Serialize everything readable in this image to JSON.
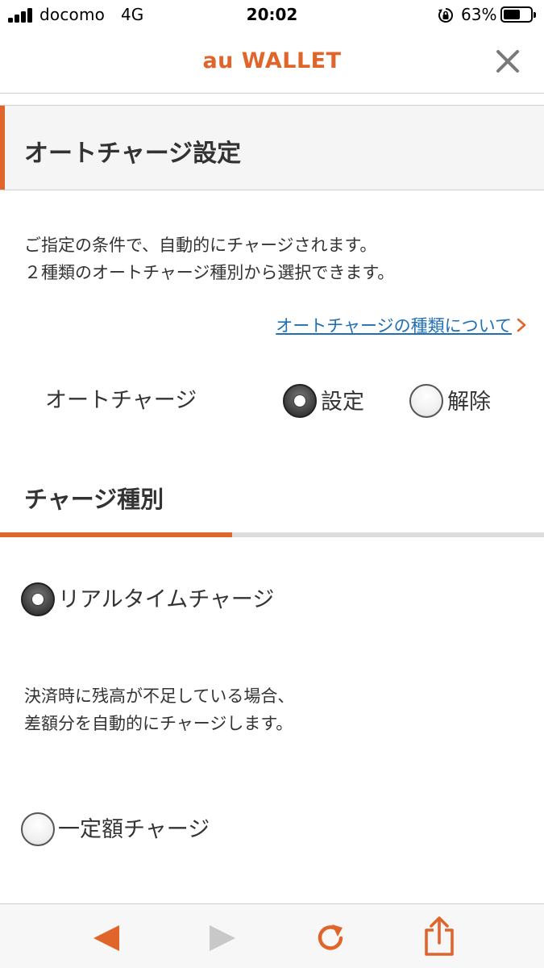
{
  "status_bar": {
    "carrier": "docomo",
    "network": "4G",
    "time": "20:02",
    "battery_percent": "63%",
    "battery_level": 0.63,
    "icons": [
      "signal-icon",
      "orientation-lock-icon",
      "battery-icon"
    ]
  },
  "header": {
    "title": "au WALLET",
    "close_icon": "close-icon"
  },
  "section": {
    "title": "オートチャージ設定"
  },
  "description": {
    "line1": "ご指定の条件で、自動的にチャージされます。",
    "line2": "２種類のオートチャージ種別から選択できます。"
  },
  "about_link": {
    "label": "オートチャージの種類について",
    "icon": "chevron-right-icon"
  },
  "autocharge": {
    "label": "オートチャージ",
    "options": [
      {
        "label": "設定",
        "selected": true
      },
      {
        "label": "解除",
        "selected": false
      }
    ]
  },
  "charge_type": {
    "heading": "チャージ種別",
    "options": [
      {
        "label": "リアルタイムチャージ",
        "selected": true,
        "description_line1": "決済時に残高が不足している場合、",
        "description_line2": "差額分を自動的にチャージします。"
      },
      {
        "label": "一定額チャージ",
        "selected": false
      }
    ]
  },
  "toolbar": {
    "items": [
      "back-icon",
      "forward-icon",
      "reload-icon",
      "share-icon"
    ]
  },
  "colors": {
    "accent": "#e0652a",
    "link": "#1f6fb4",
    "text": "#333333",
    "disabled": "#c8c8c8"
  }
}
